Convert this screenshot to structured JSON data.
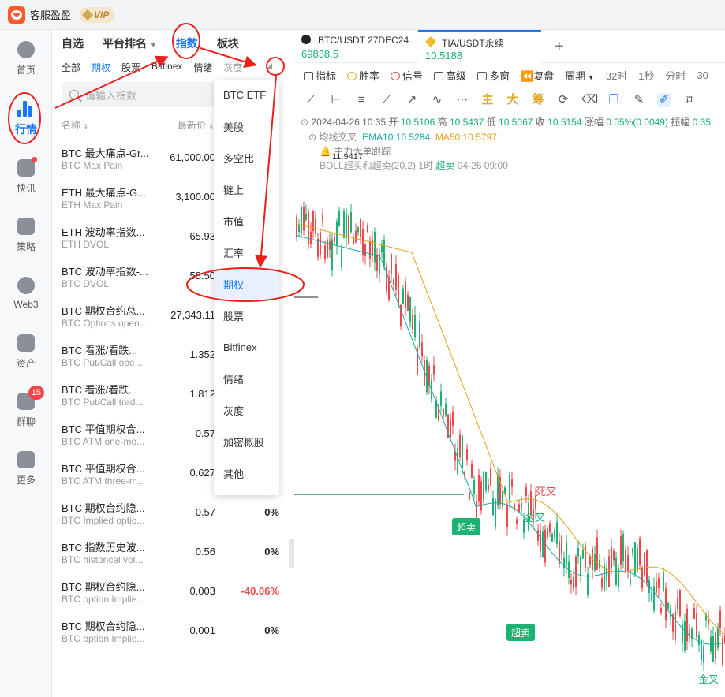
{
  "app": {
    "name": "客服盈盈",
    "vip": "VIP"
  },
  "sidebar": {
    "items": [
      {
        "label": "首页"
      },
      {
        "label": "行情"
      },
      {
        "label": "快讯"
      },
      {
        "label": "策略"
      },
      {
        "label": "Web3"
      },
      {
        "label": "资产"
      },
      {
        "label": "群聊",
        "badge": "15"
      },
      {
        "label": "更多"
      }
    ]
  },
  "market": {
    "main_tabs": [
      "自选",
      "平台排名",
      "指数",
      "板块"
    ],
    "sub_tabs": [
      "全部",
      "期权",
      "股票",
      "Bitfinex",
      "情绪",
      "灰度"
    ],
    "search_placeholder": "请输入指数",
    "col_name": "名称",
    "col_price": "最新价",
    "rows": [
      {
        "name": "BTC 最大痛点-Gr...",
        "sub": "BTC Max Pain",
        "price": "61,000.00",
        "change": ""
      },
      {
        "name": "ETH 最大痛点-G...",
        "sub": "ETH Max Pain",
        "price": "3,100.00",
        "change": ""
      },
      {
        "name": "ETH 波动率指数...",
        "sub": "ETH DVOL",
        "price": "65.93",
        "change": ""
      },
      {
        "name": "BTC 波动率指数-...",
        "sub": "BTC DVOL",
        "price": "58.50",
        "change": ""
      },
      {
        "name": "BTC 期权合约总...",
        "sub": "BTC Options open...",
        "price": "27,343.11",
        "change": ""
      },
      {
        "name": "BTC 看涨/看跌...",
        "sub": "BTC Put/Call ope...",
        "price": "1.352",
        "change": ""
      },
      {
        "name": "BTC 看涨/看跌...",
        "sub": "BTC Put/Call trad...",
        "price": "1.812",
        "change": ""
      },
      {
        "name": "BTC 平值期权合...",
        "sub": "BTC ATM one-mo...",
        "price": "0.57",
        "change": ""
      },
      {
        "name": "BTC 平值期权合...",
        "sub": "BTC ATM three-m...",
        "price": "0.627",
        "change": ""
      },
      {
        "name": "BTC 期权合约隐...",
        "sub": "BTC Implied optio...",
        "price": "0.57",
        "change": "0%"
      },
      {
        "name": "BTC 指数历史波...",
        "sub": "BTC historical vol...",
        "price": "0.56",
        "change": "0%"
      },
      {
        "name": "BTC 期权合约隐...",
        "sub": "BTC option Implie...",
        "price": "0.003",
        "change": "-40.06%"
      },
      {
        "name": "BTC 期权合约隐...",
        "sub": "BTC option Implie...",
        "price": "0.001",
        "change": "0%"
      }
    ]
  },
  "dropdown": {
    "options": [
      "BTC ETF",
      "美股",
      "多空比",
      "链上",
      "市值",
      "汇率",
      "期权",
      "股票",
      "Bitfinex",
      "情绪",
      "灰度",
      "加密概股",
      "其他"
    ],
    "selected": "期权"
  },
  "chart_tabs": [
    {
      "title": "BTC/USDT 27DEC24",
      "price": "69838.5"
    },
    {
      "title": "TIA/USDT永续",
      "price": "10.5188"
    }
  ],
  "toolbar": {
    "items": [
      "指标",
      "胜率",
      "信号",
      "高级",
      "多窗",
      "复盘",
      "周期",
      "32时",
      "1秒",
      "分时",
      "30"
    ]
  },
  "toolbar2": {
    "icons": [
      "主",
      "大",
      "筹"
    ]
  },
  "ohlc": {
    "date": "2024-04-26 10:35",
    "open_label": "开",
    "open": "10.5106",
    "high_label": "高",
    "high": "10.5437",
    "low_label": "低",
    "low": "10.5067",
    "close_label": "收",
    "close": "10.5154",
    "chg_label": "涨幅",
    "chg": "0.05%(0.0049)",
    "amp_label": "振幅",
    "amp": "0.35"
  },
  "indicators": {
    "cross_label": "均线交叉",
    "ema": "EMA10:10.5284",
    "ma": "MA50:10.5797",
    "tracker": "主力大单跟踪",
    "boll_prefix": "BOLL超买和超卖(20,2) 1时",
    "boll_signal": "超卖",
    "boll_time": "04-26 09:00",
    "peak": "11.9417"
  },
  "signals": {
    "oversold": "超卖",
    "death_cross": "死叉",
    "golden_cross": "金叉"
  },
  "colors": {
    "accent": "#1677ff",
    "up": "#1bb273",
    "down": "#f0474b",
    "ema": "#19a8a5",
    "ma": "#e3a21a"
  }
}
